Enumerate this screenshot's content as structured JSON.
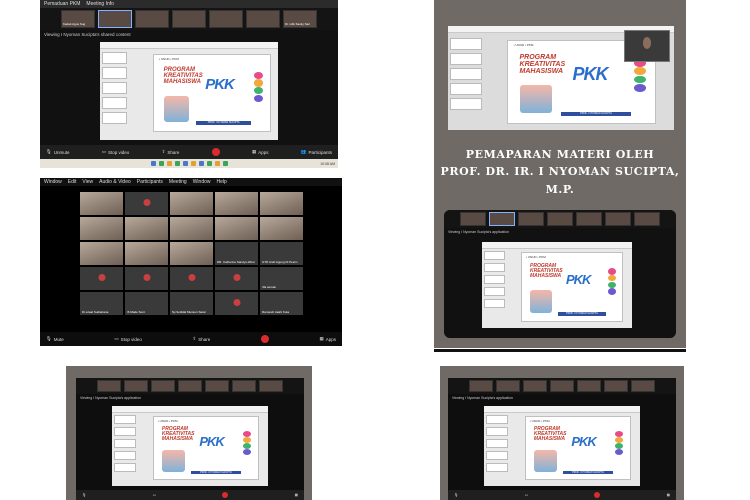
{
  "panel_a": {
    "app_title": "Pemaduan PKM",
    "meeting_info": "Meeting Info",
    "strip": [
      "Kadek Agus Sug",
      "",
      "",
      "",
      "",
      "",
      "",
      "Dr. Lilik Sasky Sari"
    ],
    "share_label": "Viewing I Nyoman Sucipta's shared content",
    "zoom_level": "100%",
    "toolbar": {
      "unmute": "Unmute",
      "stop_video": "Stop video",
      "share": "Share",
      "apps": "Apps",
      "participants": "Participants"
    },
    "clock": "10:08 AM"
  },
  "panel_b": {
    "topbar": [
      "Window",
      "Edit",
      "View",
      "Audio & Video",
      "Participants",
      "Meeting",
      "Window",
      "Help"
    ],
    "tiles": [
      {
        "name": "",
        "cam": true
      },
      {
        "name": "",
        "cam": false,
        "avatar": true
      },
      {
        "name": "",
        "cam": true
      },
      {
        "name": "",
        "cam": true
      },
      {
        "name": "",
        "cam": true
      },
      {
        "name": "",
        "cam": true
      },
      {
        "name": "",
        "cam": true
      },
      {
        "name": "",
        "cam": true
      },
      {
        "name": "",
        "cam": true
      },
      {
        "name": "",
        "cam": true
      },
      {
        "name": "",
        "cam": true
      },
      {
        "name": "",
        "cam": true
      },
      {
        "name": "",
        "cam": true
      },
      {
        "name": "DR. Catherine Sandys-Wirel",
        "cam": false
      },
      {
        "name": "GTD Arah Agung Di Pesim",
        "cam": false
      },
      {
        "name": "",
        "cam": false,
        "avatar": true
      },
      {
        "name": "",
        "cam": false,
        "avatar": true
      },
      {
        "name": "",
        "cam": false,
        "avatar": true
      },
      {
        "name": "",
        "cam": false,
        "avatar": true
      },
      {
        "name": "rifa seruan",
        "cam": false
      },
      {
        "name": "Dr.ezaal Sudiartana",
        "cam": false
      },
      {
        "name": "I6 Made Sunt",
        "cam": false
      },
      {
        "name": "Ny.Sotlidal Munsun Saral",
        "cam": false
      },
      {
        "name": "",
        "cam": false,
        "avatar": true
      },
      {
        "name": "Ramandi Jaahi Kuta",
        "cam": false
      }
    ],
    "toolbar": {
      "mute": "Mute",
      "stop_video": "Stop video",
      "share": "Share",
      "apps": "Apps"
    }
  },
  "slide": {
    "logos": "• UNUD • PKM",
    "program": "PROGRAM KREATIVITAS MAHASISWA",
    "logo_text": "PKK",
    "footer": "PROF. I NYOMAN SUCIPTA",
    "drop_colors": [
      "#e94b8a",
      "#f2a93b",
      "#3fb36b",
      "#6a5acd"
    ]
  },
  "heading": {
    "line1": "PEMAPARAN MATERI OLEH",
    "line2": "PROF. DR. IR. I NYOMAN SUCIPTA, M.P."
  },
  "panel_c": {
    "share_label": "Viewing I Nyoman Sucipta's application"
  },
  "panel_d": {
    "share_label": "Viewing I Nyoman Sucipta's application"
  },
  "panel_e": {
    "share_label": "Viewing I Nyoman Sucipta's application"
  }
}
